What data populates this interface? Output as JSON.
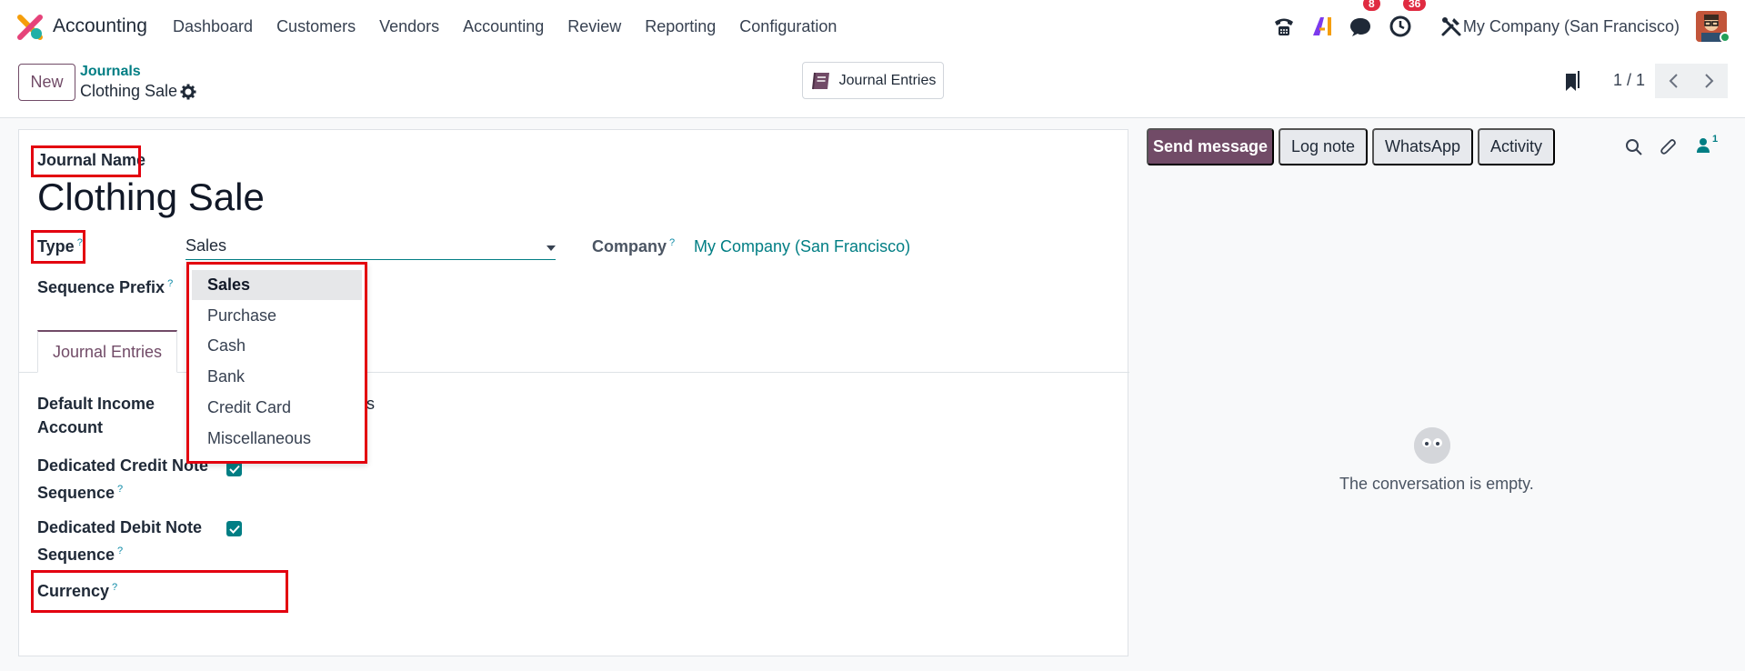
{
  "navbar": {
    "app_name": "Accounting",
    "menu": [
      "Dashboard",
      "Customers",
      "Vendors",
      "Accounting",
      "Review",
      "Reporting",
      "Configuration"
    ],
    "messages_badge": "8",
    "activities_badge": "36",
    "company": "My Company (San Francisco)"
  },
  "control": {
    "new_label": "New",
    "breadcrumb_parent": "Journals",
    "breadcrumb_current": "Clothing Sale",
    "journal_entries_button": "Journal Entries",
    "pager": "1 / 1"
  },
  "form": {
    "journal_name_label": "Journal Name",
    "journal_name_value": "Clothing Sale",
    "type_label": "Type",
    "type_value": "Sales",
    "company_label": "Company",
    "company_value": "My Company (San Francisco)",
    "sequence_prefix_label": "Sequence Prefix",
    "tab_journal_entries": "Journal Entries",
    "default_income_label_1": "Default Income",
    "default_income_label_2": "Account",
    "default_income_value_fragment": "s",
    "credit_note_label_1": "Dedicated Credit Note",
    "credit_note_label_2": "Sequence",
    "debit_note_label_1": "Dedicated Debit Note",
    "debit_note_label_2": "Sequence",
    "currency_label": "Currency",
    "help_mark": "?"
  },
  "type_dropdown": {
    "options": [
      "Sales",
      "Purchase",
      "Cash",
      "Bank",
      "Credit Card",
      "Miscellaneous"
    ],
    "selected": "Sales"
  },
  "chatter": {
    "send_message": "Send message",
    "log_note": "Log note",
    "whatsapp": "WhatsApp",
    "activity": "Activity",
    "followers_count": "1",
    "empty_text": "The conversation is empty."
  },
  "colors": {
    "brand": "#714b67",
    "link": "#017e84",
    "highlight": "#e3000f"
  }
}
